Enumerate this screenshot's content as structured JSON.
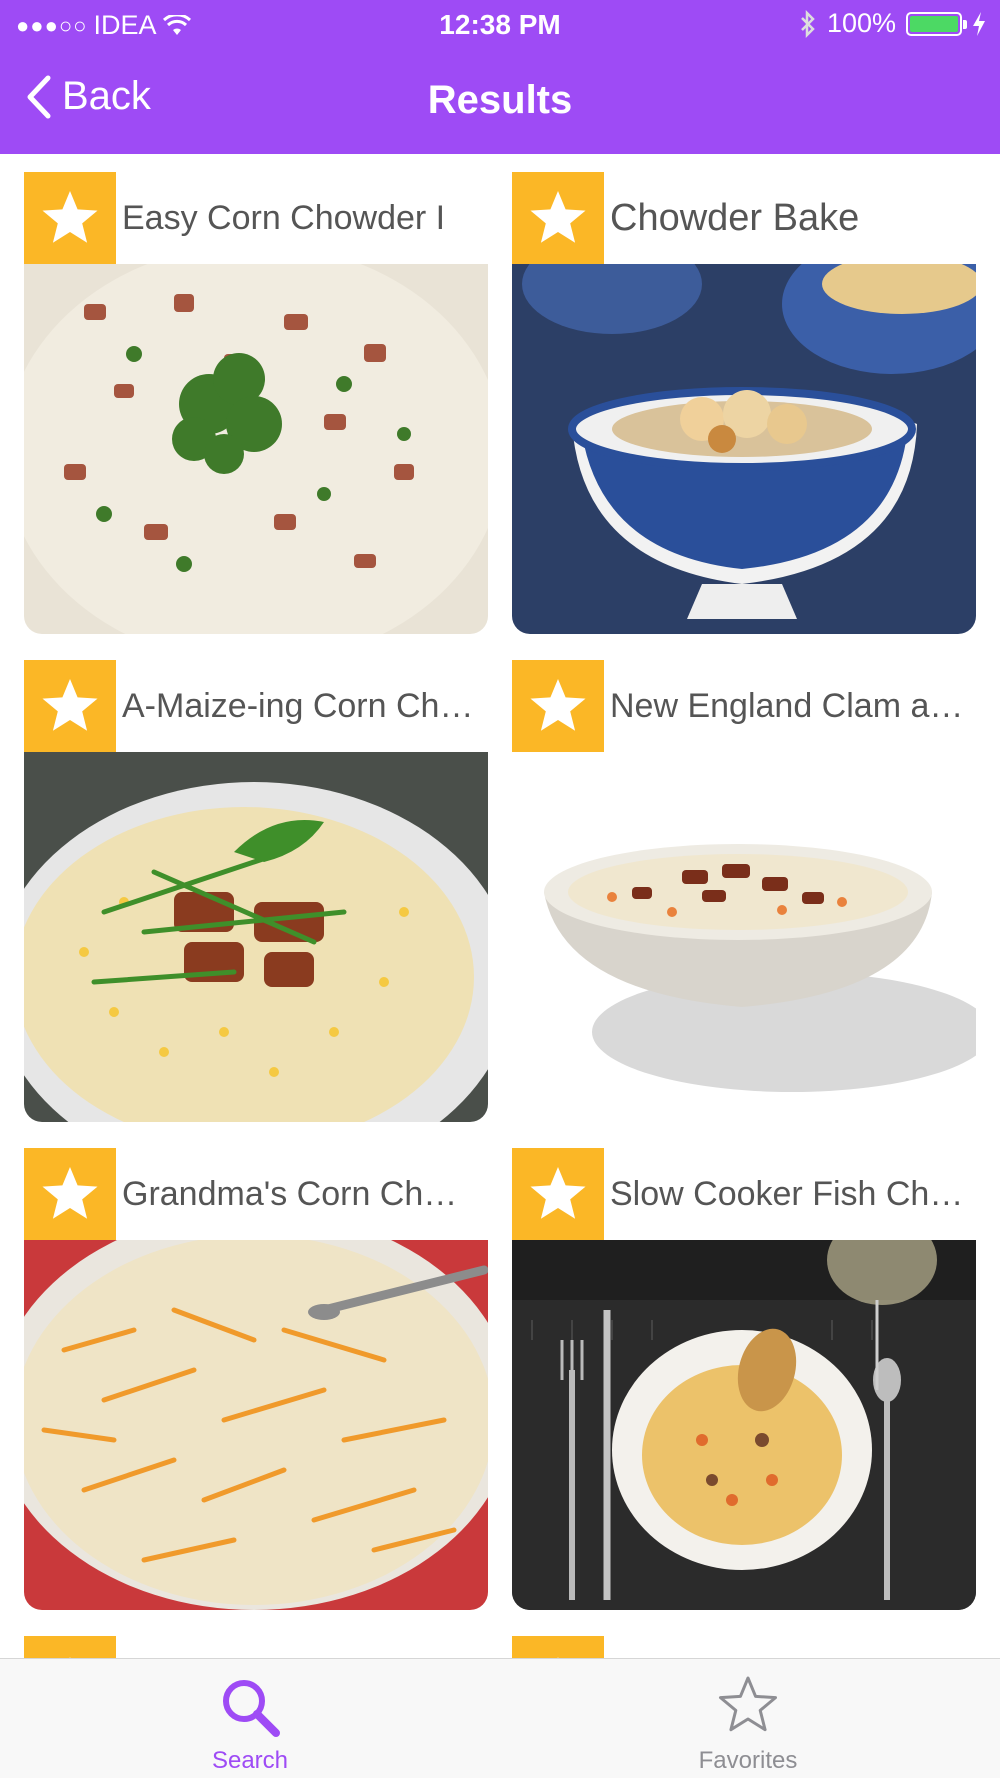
{
  "status_bar": {
    "carrier": "IDEA",
    "time": "12:38 PM",
    "battery_percent": "100%",
    "battery_level": 1.0
  },
  "nav": {
    "back_label": "Back",
    "title": "Results"
  },
  "results": [
    {
      "title": "Easy Corn Chowder I",
      "image": "corn-chowder-bacon-parsley"
    },
    {
      "title": "Chowder Bake",
      "image": "blue-bowl-oyster-crackers"
    },
    {
      "title": "A-Maize-ing Corn Ch…",
      "image": "corn-chowder-bacon-chives"
    },
    {
      "title": "New England Clam a…",
      "image": "clam-chowder-white-bowl"
    },
    {
      "title": "Grandma's Corn Ch…",
      "image": "corn-chowder-cheddar"
    },
    {
      "title": "Slow Cooker Fish Ch…",
      "image": "fish-chowder-table-setting"
    }
  ],
  "tabs": [
    {
      "label": "Search",
      "icon": "search-icon",
      "active": true
    },
    {
      "label": "Favorites",
      "icon": "star-outline-icon",
      "active": false
    }
  ],
  "colors": {
    "header": "#9E4BF5",
    "favorite_badge": "#FBB726",
    "active_tab": "#9E4BF5",
    "inactive_tab": "#8e8e93"
  }
}
